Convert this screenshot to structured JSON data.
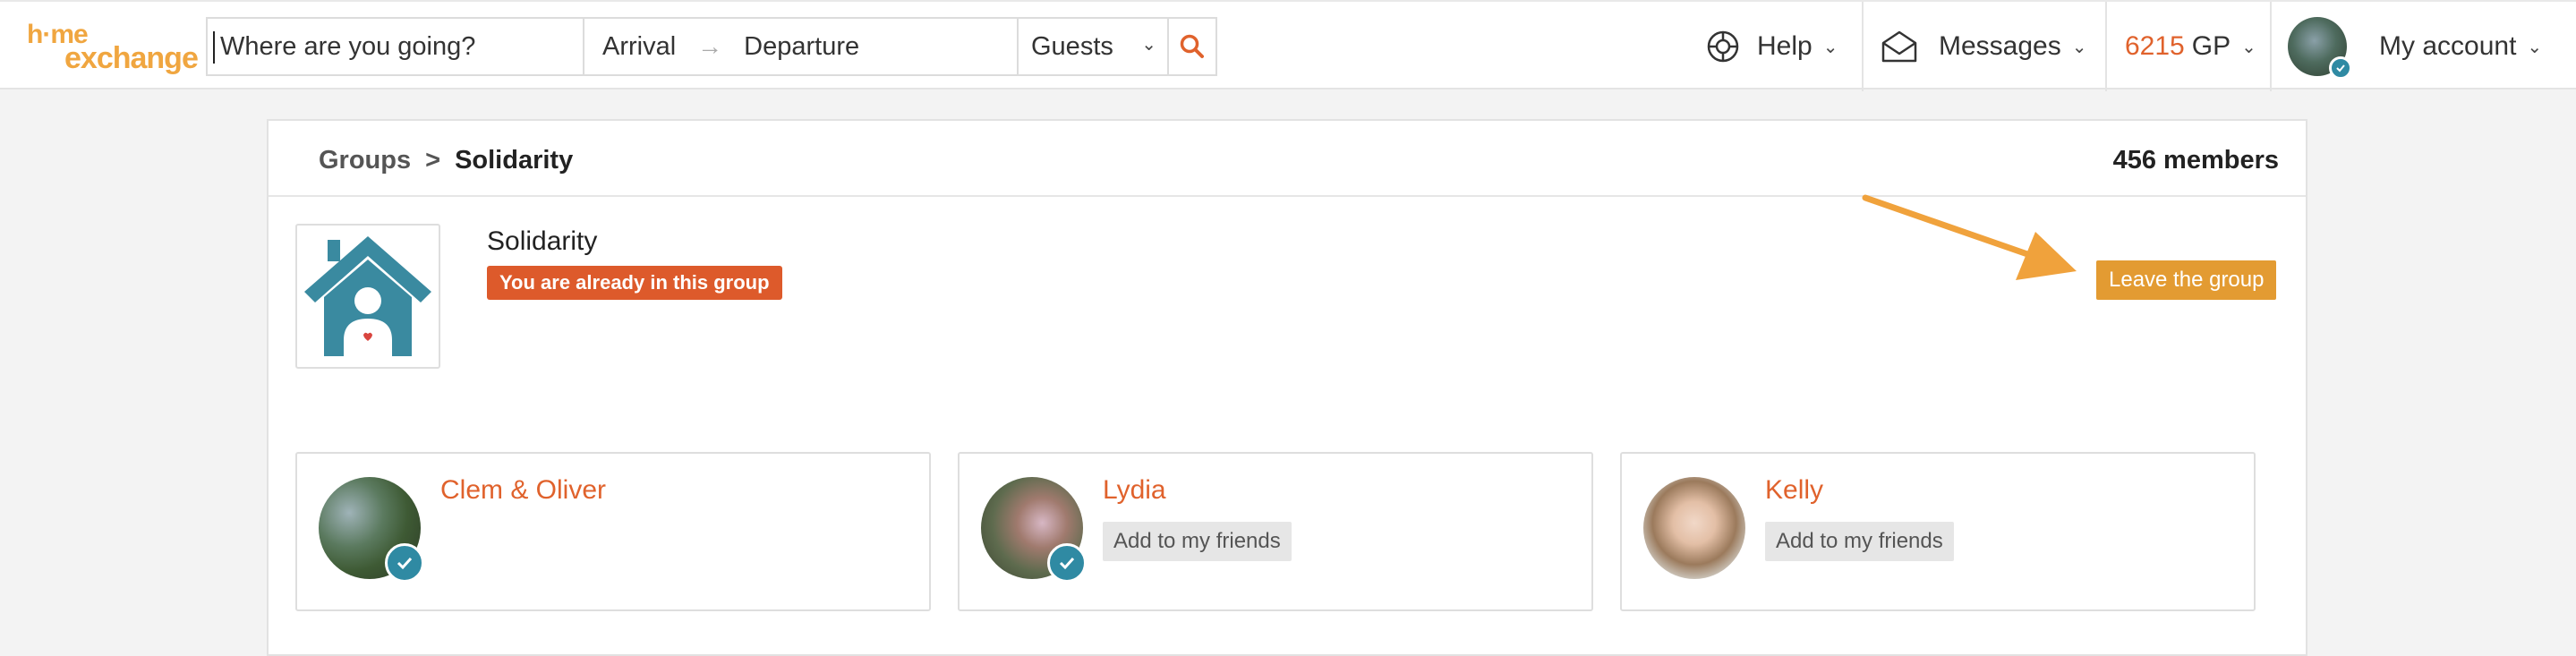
{
  "logo": {
    "line1": "h·me",
    "line2": "exchange"
  },
  "search": {
    "where_placeholder": "Where are you going?",
    "arrival": "Arrival",
    "arrow": "→",
    "departure": "Departure",
    "guests": "Guests"
  },
  "nav": {
    "help": "Help",
    "messages": "Messages",
    "gp_value": "6215",
    "gp_unit": "GP",
    "account": "My account"
  },
  "breadcrumb": {
    "parent": "Groups",
    "separator": ">",
    "current": "Solidarity"
  },
  "members_count": "456 members",
  "group": {
    "name": "Solidarity",
    "status_badge": "You are already in this group",
    "leave_button": "Leave the group"
  },
  "members": [
    {
      "name": "Clem & Oliver",
      "add_friend": "",
      "verified": true
    },
    {
      "name": "Lydia",
      "add_friend": "Add to my friends",
      "verified": true
    },
    {
      "name": "Kelly",
      "add_friend": "Add to my friends",
      "verified": false
    }
  ],
  "colors": {
    "brand": "#f0a640",
    "accent": "#e0622c",
    "leave_button": "#e39b32",
    "badge_verified": "#2f8aa3",
    "house_icon": "#3a8aa0"
  }
}
